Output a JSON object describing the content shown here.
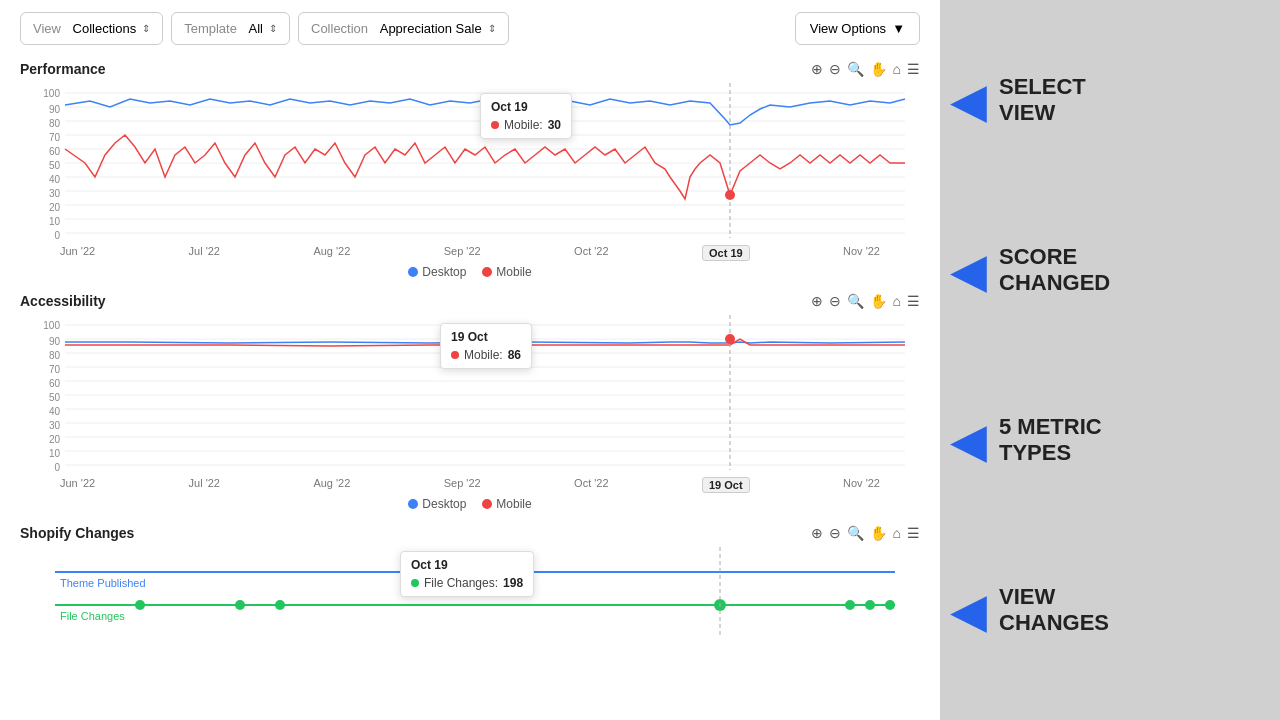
{
  "header": {
    "view_label": "View",
    "view_value": "Collections",
    "template_label": "Template",
    "template_value": "All",
    "collection_label": "Collection",
    "collection_value": "Appreciation Sale",
    "view_options_label": "View Options"
  },
  "performance": {
    "title": "Performance",
    "tooltip_date": "Oct 19",
    "tooltip_metric": "Mobile:",
    "tooltip_value": "30",
    "x_labels": [
      "Jun '22",
      "Jul '22",
      "Aug '22",
      "Sep '22",
      "Oct '22",
      "Oct 19",
      "Nov '22"
    ],
    "legend_desktop": "Desktop",
    "legend_mobile": "Mobile",
    "y_labels": [
      "100",
      "90",
      "80",
      "70",
      "60",
      "50",
      "40",
      "30",
      "20",
      "10",
      "0"
    ]
  },
  "accessibility": {
    "title": "Accessibility",
    "tooltip_date": "19 Oct",
    "tooltip_metric": "Mobile:",
    "tooltip_value": "86",
    "x_labels": [
      "Jun '22",
      "Jul '22",
      "Aug '22",
      "Sep '22",
      "Oct '22",
      "19 Oct",
      "Nov '22"
    ],
    "legend_desktop": "Desktop",
    "legend_mobile": "Mobile",
    "y_labels": [
      "100",
      "90",
      "80",
      "70",
      "60",
      "50",
      "40",
      "30",
      "20",
      "10",
      "0"
    ]
  },
  "shopify_changes": {
    "title": "Shopify Changes",
    "tooltip_date": "Oct 19",
    "tooltip_metric": "File Changes:",
    "tooltip_value": "198"
  },
  "sidebar": {
    "items": [
      {
        "id": "select-view",
        "arrow": "◀",
        "line1": "SELECT",
        "line2": "VIEW"
      },
      {
        "id": "score-changed",
        "arrow": "◀",
        "line1": "SCORE",
        "line2": "CHANGED"
      },
      {
        "id": "metric-types",
        "arrow": "◀",
        "line1": "5 METRIC",
        "line2": "TYPES"
      },
      {
        "id": "view-changes",
        "arrow": "◀",
        "line1": "VIEW",
        "line2": "CHANGES"
      }
    ]
  },
  "colors": {
    "desktop": "#3b82f6",
    "mobile": "#ef4444",
    "green": "#22c55e",
    "tooltip_bg": "#ffffff"
  }
}
